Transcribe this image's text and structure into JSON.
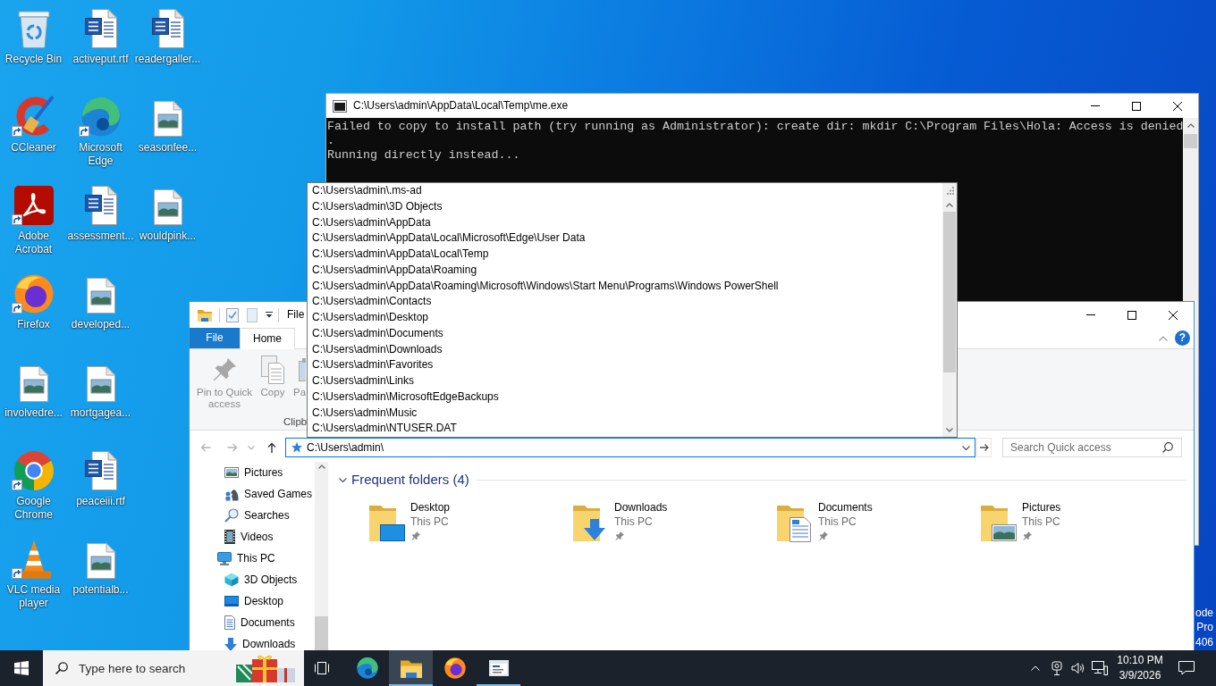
{
  "desktop": {
    "icons": [
      {
        "label": "Recycle Bin",
        "kind": "bin",
        "shortcut": false,
        "selected": false
      },
      {
        "label": "CCleaner",
        "kind": "ccleaner",
        "shortcut": true,
        "selected": false
      },
      {
        "label": "Adobe Acrobat",
        "kind": "acrobat",
        "shortcut": true,
        "selected": false
      },
      {
        "label": "Firefox",
        "kind": "firefox",
        "shortcut": true,
        "selected": false
      },
      {
        "label": "involvedre...",
        "kind": "image",
        "shortcut": false,
        "selected": false
      },
      {
        "label": "Google Chrome",
        "kind": "chrome",
        "shortcut": true,
        "selected": false
      },
      {
        "label": "VLC media player",
        "kind": "vlc",
        "shortcut": true,
        "selected": false
      },
      {
        "label": "activeput.rtf",
        "kind": "word",
        "shortcut": false,
        "selected": false
      },
      {
        "label": "Microsoft Edge",
        "kind": "edge",
        "shortcut": true,
        "selected": false
      },
      {
        "label": "assessment...",
        "kind": "word",
        "shortcut": false,
        "selected": false
      },
      {
        "label": "developed...",
        "kind": "image",
        "shortcut": false,
        "selected": false
      },
      {
        "label": "mortgagea...",
        "kind": "image",
        "shortcut": false,
        "selected": false
      },
      {
        "label": "peaceiii.rtf",
        "kind": "word",
        "shortcut": false,
        "selected": false
      },
      {
        "label": "potentialb...",
        "kind": "image",
        "shortcut": false,
        "selected": false
      },
      {
        "label": "readergaller...",
        "kind": "word",
        "shortcut": false,
        "selected": false
      },
      {
        "label": "seasonfee...",
        "kind": "image",
        "shortcut": false,
        "selected": false
      },
      {
        "label": "wouldpink...",
        "kind": "image",
        "shortcut": false,
        "selected": false
      }
    ],
    "status_text": [
      "ode",
      "Pro",
      "406"
    ]
  },
  "console_window": {
    "title": "C:\\Users\\admin\\AppData\\Local\\Temp\\me.exe",
    "lines": [
      "Failed to copy to install path (try running as Administrator): create dir: mkdir C:\\Program Files\\Hola: Access is denied",
      ".",
      "Running directly instead..."
    ]
  },
  "explorer_window": {
    "title": "File",
    "ribbon_tabs": [
      {
        "label": "File",
        "kind": "menu",
        "selected": false
      },
      {
        "label": "Home",
        "kind": "tab",
        "selected": true
      }
    ],
    "help_label": "?",
    "ribbon_commands": [
      {
        "label": "Pin to Quick access",
        "kind": "pin",
        "disabled": true
      },
      {
        "label": "Copy",
        "kind": "copy",
        "disabled": true
      },
      {
        "label": "Pa",
        "kind": "paste",
        "disabled": true
      }
    ],
    "ribbon_group": "Clipb",
    "nav_buttons": [
      {
        "kind": "back",
        "disabled": true
      },
      {
        "kind": "forward",
        "disabled": true
      },
      {
        "kind": "recent",
        "disabled": true
      },
      {
        "kind": "up",
        "disabled": false
      }
    ],
    "address_bar": {
      "value": "C:\\Users\\admin\\",
      "focused": true
    },
    "search": {
      "placeholder": "Search Quick access"
    },
    "navigation_tree": [
      {
        "children": [
          {
            "label": "Pictures",
            "kind": "pictures",
            "selected": false
          },
          {
            "label": "Saved Games",
            "kind": "games",
            "selected": false
          },
          {
            "label": "Searches",
            "kind": "searches",
            "selected": false
          },
          {
            "label": "Videos",
            "kind": "videos",
            "selected": false
          }
        ]
      },
      {
        "label": "This PC",
        "kind": "computer",
        "selected": false,
        "children": [
          {
            "label": "3D Objects",
            "kind": "objects",
            "selected": false
          },
          {
            "label": "Desktop",
            "kind": "desktop",
            "selected": false
          },
          {
            "label": "Documents",
            "kind": "documents",
            "selected": false
          },
          {
            "label": "Downloads",
            "kind": "downloads",
            "selected": false
          }
        ]
      }
    ],
    "frequent_folders": {
      "title": "Frequent folders (4)",
      "expanded": true,
      "folders": [
        {
          "label": "Desktop",
          "location": "This PC",
          "kind": "desktop",
          "selected": false
        },
        {
          "label": "Downloads",
          "location": "This PC",
          "kind": "downloads",
          "selected": false
        },
        {
          "label": "Documents",
          "location": "This PC",
          "kind": "documents",
          "selected": false
        },
        {
          "label": "Pictures",
          "location": "This PC",
          "kind": "pictures",
          "selected": false
        }
      ]
    }
  },
  "autocomplete": {
    "items": [
      {
        "label": "C:\\Users\\admin\\.ms-ad",
        "selected": false
      },
      {
        "label": "C:\\Users\\admin\\3D Objects",
        "selected": false
      },
      {
        "label": "C:\\Users\\admin\\AppData",
        "selected": false
      },
      {
        "label": "C:\\Users\\admin\\AppData\\Local\\Microsoft\\Edge\\User Data",
        "selected": false
      },
      {
        "label": "C:\\Users\\admin\\AppData\\Local\\Temp",
        "selected": false
      },
      {
        "label": "C:\\Users\\admin\\AppData\\Roaming",
        "selected": false
      },
      {
        "label": "C:\\Users\\admin\\AppData\\Roaming\\Microsoft\\Windows\\Start Menu\\Programs\\Windows PowerShell",
        "selected": false
      },
      {
        "label": "C:\\Users\\admin\\Contacts",
        "selected": false
      },
      {
        "label": "C:\\Users\\admin\\Desktop",
        "selected": false
      },
      {
        "label": "C:\\Users\\admin\\Documents",
        "selected": false
      },
      {
        "label": "C:\\Users\\admin\\Downloads",
        "selected": false
      },
      {
        "label": "C:\\Users\\admin\\Favorites",
        "selected": false
      },
      {
        "label": "C:\\Users\\admin\\Links",
        "selected": false
      },
      {
        "label": "C:\\Users\\admin\\MicrosoftEdgeBackups",
        "selected": false
      },
      {
        "label": "C:\\Users\\admin\\Music",
        "selected": false
      },
      {
        "label": "C:\\Users\\admin\\NTUSER.DAT",
        "selected": false
      }
    ]
  },
  "taskbar": {
    "search_placeholder": "Type here to search",
    "apps": [
      {
        "kind": "taskview",
        "running": false,
        "active": false
      },
      {
        "kind": "edge",
        "running": false,
        "active": false
      },
      {
        "kind": "explorer",
        "running": true,
        "active": true
      },
      {
        "kind": "firefox",
        "running": false,
        "active": false
      },
      {
        "kind": "console",
        "running": true,
        "active": false
      }
    ],
    "clock": {
      "time": "10:10 PM",
      "date": "3/9/2026"
    }
  }
}
